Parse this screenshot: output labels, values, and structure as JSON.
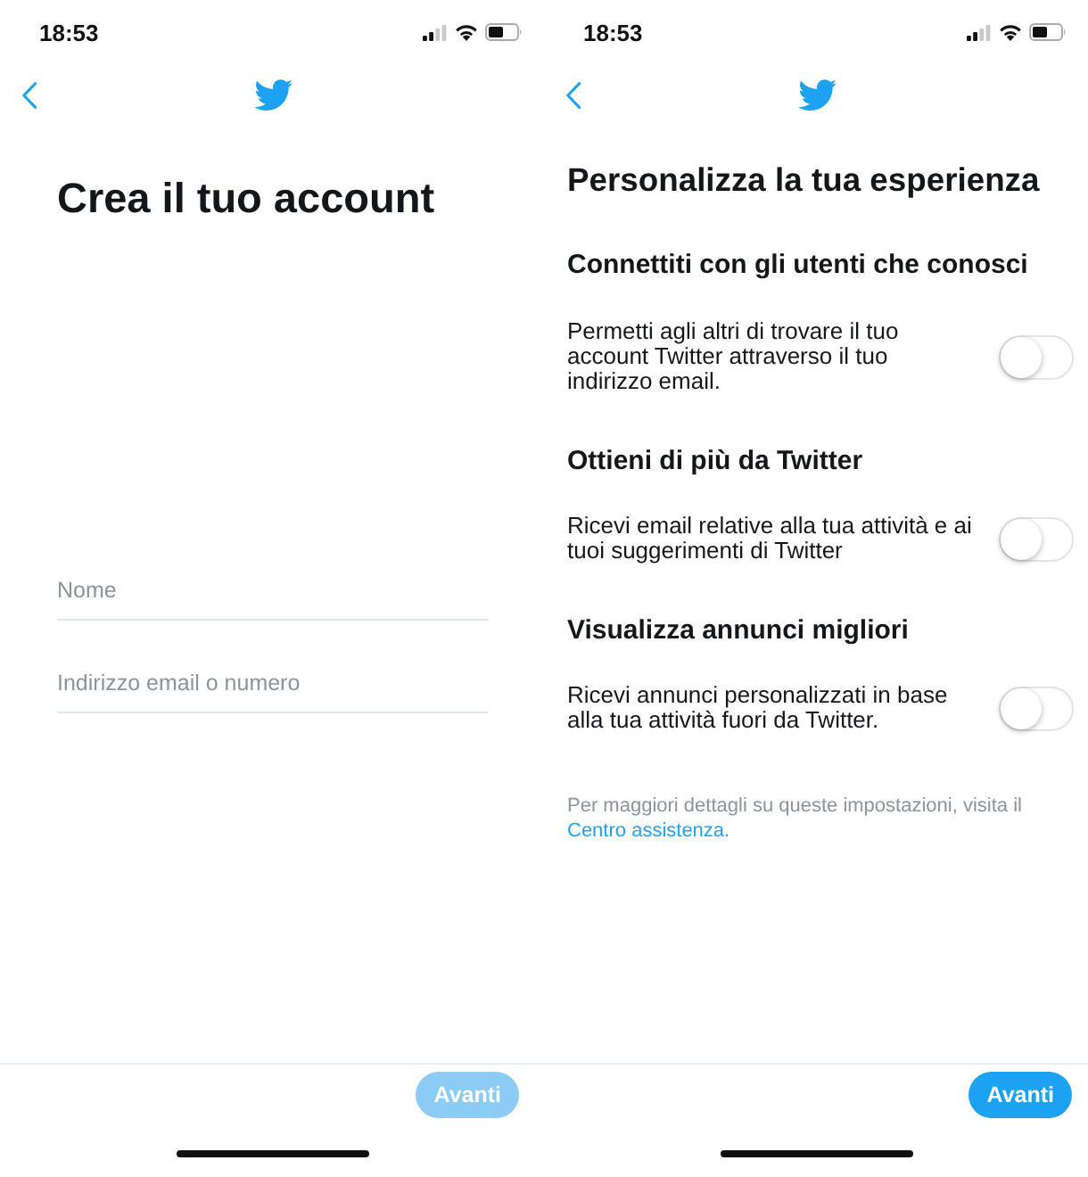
{
  "screens": [
    {
      "kind": "form",
      "status_bar": {
        "time": "18:53"
      },
      "title": "Crea il tuo account",
      "fields": [
        {
          "placeholder": "Nome"
        },
        {
          "placeholder": "Indirizzo email o numero"
        }
      ],
      "next_button": {
        "label": "Avanti",
        "disabled": true
      }
    },
    {
      "kind": "settings",
      "status_bar": {
        "time": "18:53"
      },
      "title": "Personalizza la tua esperienza",
      "sections": [
        {
          "heading": "Connettiti con gli utenti che conosci",
          "description": "Permetti agli altri di trovare il tuo account Twitter attraverso il tuo indirizzo email.",
          "on": false
        },
        {
          "heading": "Ottieni di più da Twitter",
          "description": "Ricevi email relative alla tua attività e ai tuoi suggerimenti di Twitter",
          "on": false
        },
        {
          "heading": "Visualizza annunci migliori",
          "description": "Ricevi annunci personalizzati in base alla tua attività fuori da Twitter.",
          "on": false
        }
      ],
      "footnote": {
        "text": "Per maggiori dettagli su queste impostazioni, visita il",
        "link": "Centro assistenza."
      },
      "next_button": {
        "label": "Avanti",
        "disabled": false
      }
    }
  ]
}
